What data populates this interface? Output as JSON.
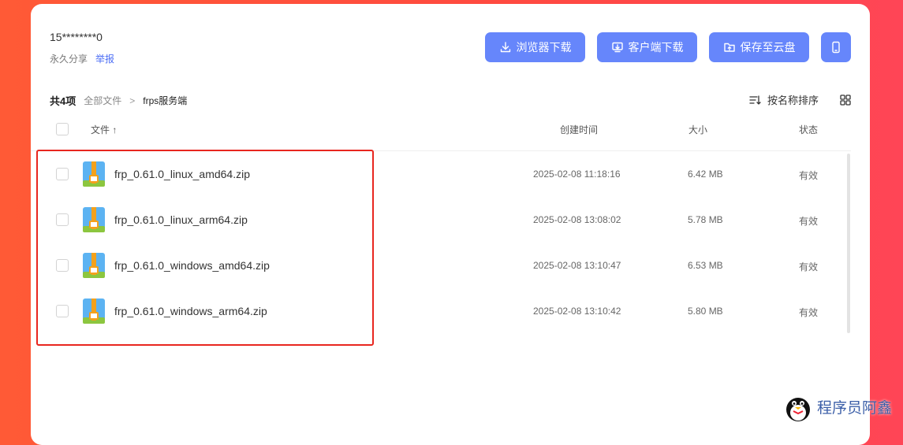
{
  "share": {
    "code": "15********0",
    "validity": "永久分享",
    "report_label": "举报"
  },
  "buttons": {
    "browser_download": "浏览器下载",
    "client_download": "客户端下载",
    "save_to_cloud": "保存至云盘"
  },
  "breadcrumb": {
    "count": "共4项",
    "root": "全部文件",
    "separator": ">",
    "current": "frps服务端"
  },
  "sort": {
    "label": "按名称排序"
  },
  "table": {
    "headers": {
      "file": "文件 ↑",
      "created": "创建时间",
      "size": "大小",
      "status": "状态"
    },
    "rows": [
      {
        "name": "frp_0.61.0_linux_amd64.zip",
        "date": "2025-02-08 11:18:16",
        "size": "6.42 MB",
        "status": "有效"
      },
      {
        "name": "frp_0.61.0_linux_arm64.zip",
        "date": "2025-02-08 13:08:02",
        "size": "5.78 MB",
        "status": "有效"
      },
      {
        "name": "frp_0.61.0_windows_amd64.zip",
        "date": "2025-02-08 13:10:47",
        "size": "6.53 MB",
        "status": "有效"
      },
      {
        "name": "frp_0.61.0_windows_arm64.zip",
        "date": "2025-02-08 13:10:42",
        "size": "5.80 MB",
        "status": "有效"
      }
    ]
  },
  "watermark": {
    "text": "程序员阿鑫"
  },
  "colors": {
    "accent": "#6686fb",
    "link": "#4c6ef5",
    "highlight": "#e8261f",
    "background": "#ff4a40"
  }
}
